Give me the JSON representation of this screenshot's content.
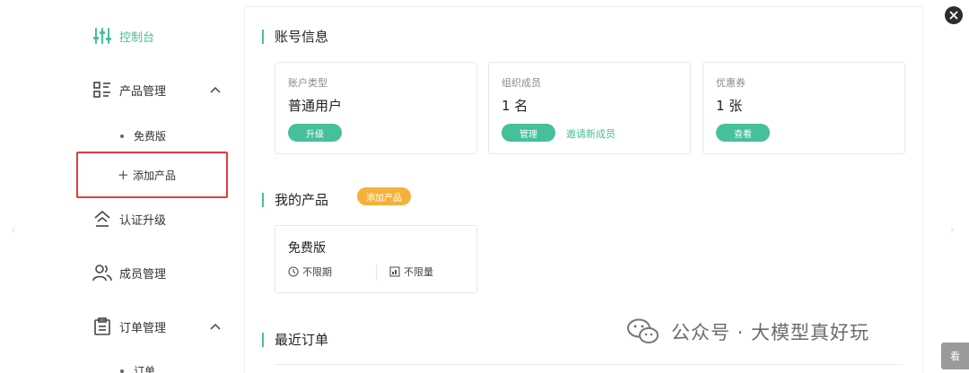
{
  "sidebar": {
    "dashboard": "控制台",
    "product_mgmt": "产品管理",
    "free_edition": "免费版",
    "add_product": "添加产品",
    "cert_upgrade": "认证升级",
    "member_mgmt": "成员管理",
    "order_mgmt": "订单管理",
    "orders": "订单"
  },
  "account": {
    "title": "账号信息",
    "cards": [
      {
        "label": "账户类型",
        "value": "普通用户",
        "button": "升级"
      },
      {
        "label": "组织成员",
        "value": "1 名",
        "button": "管理",
        "link": "邀请新成员"
      },
      {
        "label": "优惠券",
        "value": "1 张",
        "button": "查看"
      }
    ]
  },
  "products": {
    "title": "我的产品",
    "add_badge": "添加产品",
    "card": {
      "name": "免费版",
      "term": "不限期",
      "quota": "不限量"
    }
  },
  "orders": {
    "title": "最近订单"
  },
  "watermark": "公众号 · 大模型真好玩",
  "corner_tab": "看",
  "colors": {
    "accent": "#45c09a",
    "badge": "#f6b13b",
    "highlight": "#e23b3b"
  }
}
